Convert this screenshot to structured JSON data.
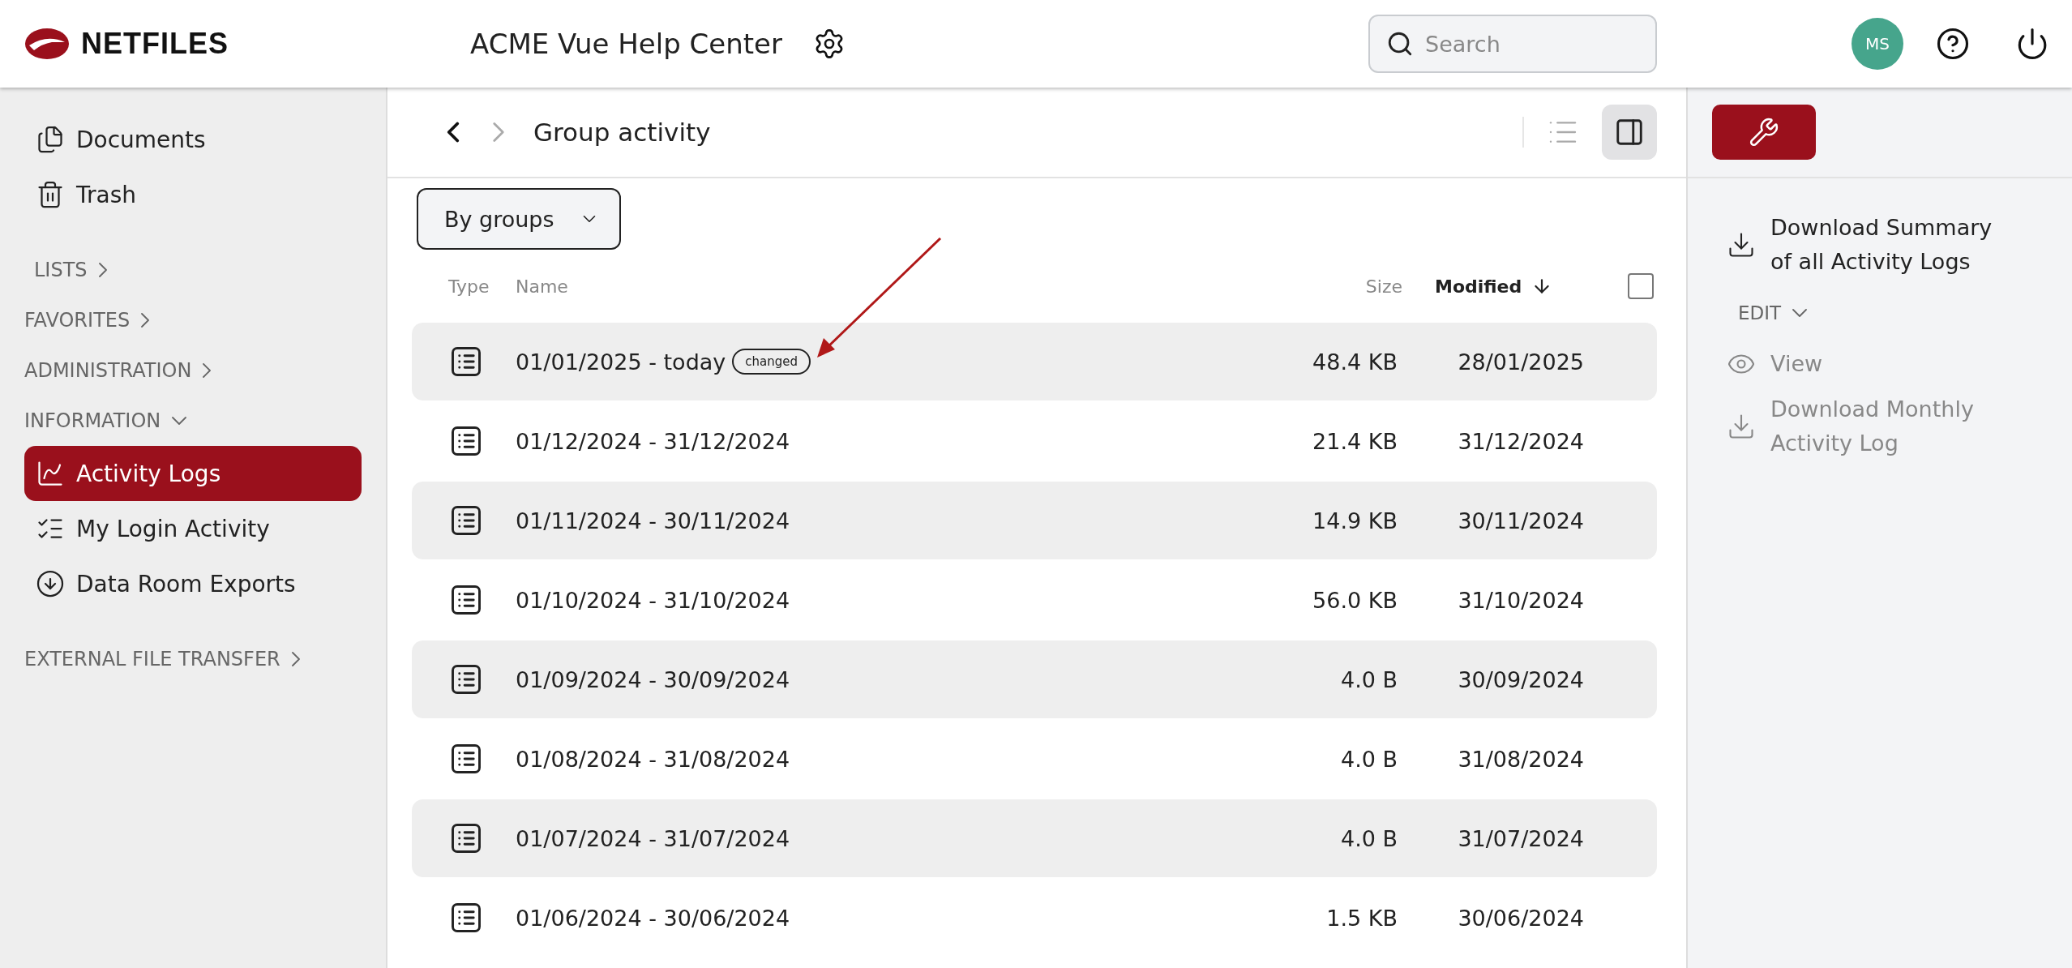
{
  "header": {
    "logo": "NETFILES",
    "title": "ACME Vue Help Center",
    "search": {
      "placeholder": "Search"
    },
    "avatar": "MS"
  },
  "sidebar": {
    "items": [
      {
        "kind": "item",
        "label": "Documents",
        "selected": false
      },
      {
        "kind": "item",
        "label": "Trash",
        "selected": false
      },
      {
        "kind": "section",
        "label": "LISTS",
        "expanded": false
      },
      {
        "kind": "section",
        "label": "FAVORITES",
        "expanded": false
      },
      {
        "kind": "section",
        "label": "ADMINISTRATION",
        "expanded": false
      },
      {
        "kind": "section",
        "label": "INFORMATION",
        "expanded": true
      },
      {
        "kind": "item",
        "label": "Activity Logs",
        "selected": true
      },
      {
        "kind": "item",
        "label": "My Login Activity",
        "selected": false
      },
      {
        "kind": "item",
        "label": "Data Room Exports",
        "selected": false
      },
      {
        "kind": "section",
        "label": "EXTERNAL FILE TRANSFER",
        "expanded": false
      }
    ]
  },
  "breadcrumb": {
    "title": "Group activity"
  },
  "filter": {
    "value": "By groups"
  },
  "table": {
    "columns": [
      {
        "label": "Type",
        "sorted": false
      },
      {
        "label": "Name",
        "sorted": false
      },
      {
        "label": "Size",
        "sorted": false
      },
      {
        "label": "Modified",
        "sorted": true
      }
    ],
    "select_all_checked": false,
    "rows": [
      {
        "name": "01/01/2025 - today",
        "badge": "changed",
        "size": "48.4 KB",
        "modified": "28/01/2025"
      },
      {
        "name": "01/12/2024 - 31/12/2024",
        "size": "21.4 KB",
        "modified": "31/12/2024"
      },
      {
        "name": "01/11/2024 - 30/11/2024",
        "size": "14.9 KB",
        "modified": "30/11/2024"
      },
      {
        "name": "01/10/2024 - 31/10/2024",
        "size": "56.0 KB",
        "modified": "31/10/2024"
      },
      {
        "name": "01/09/2024 - 30/09/2024",
        "size": "4.0 B",
        "modified": "30/09/2024"
      },
      {
        "name": "01/08/2024 - 31/08/2024",
        "size": "4.0 B",
        "modified": "31/08/2024"
      },
      {
        "name": "01/07/2024 - 31/07/2024",
        "size": "4.0 B",
        "modified": "31/07/2024"
      },
      {
        "name": "01/06/2024 - 30/06/2024",
        "size": "1.5 KB",
        "modified": "30/06/2024"
      }
    ]
  },
  "panel": {
    "actions": [
      {
        "kind": "action",
        "label": "Download Summary of all Activity Logs",
        "disabled": false
      },
      {
        "kind": "section",
        "label": "EDIT",
        "expanded": true
      },
      {
        "kind": "action",
        "label": "View",
        "disabled": true
      },
      {
        "kind": "action",
        "label": "Download Monthly Activity Log",
        "disabled": true
      }
    ]
  }
}
